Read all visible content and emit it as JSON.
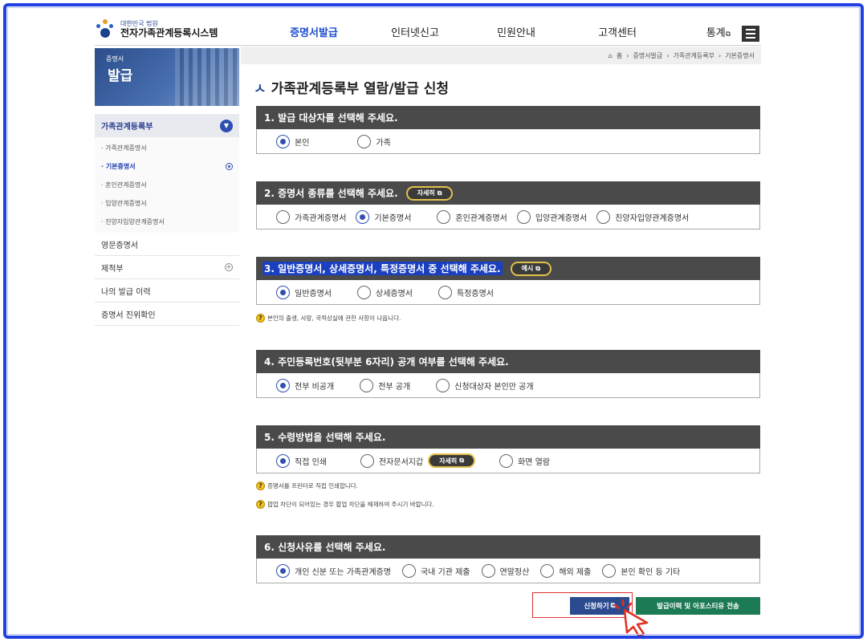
{
  "header": {
    "logo_small": "대한민국 법원",
    "logo_title": "전자가족관계등록시스템",
    "nav": [
      "증명서발급",
      "인터넷신고",
      "민원안내",
      "고객센터",
      "통계"
    ],
    "nav_active_index": 0,
    "stats_ext_icon": "external-link-icon",
    "menu_icon": "hamburger-icon"
  },
  "breadcrumb": {
    "home_icon": "home-icon",
    "items": [
      "홈",
      "증명서발급",
      "가족관계등록부",
      "기본증명서"
    ]
  },
  "sidebar": {
    "banner_small": "증명서",
    "banner_big": "발급",
    "category": "가족관계등록부",
    "sub_items": [
      "· 가족관계증명서",
      "· 기본증명서",
      "· 혼인관계증명서",
      "· 입양관계증명서",
      "· 친양자입양관계증명서"
    ],
    "sub_active_index": 1,
    "items": [
      "영문증명서",
      "제적부",
      "나의 발급 이력",
      "증명서 진위확인"
    ]
  },
  "page_title": "가족관계등록부 열람/발급 신청",
  "sections": {
    "s1": {
      "title": "1. 발급 대상자를 선택해 주세요.",
      "options": [
        "본인",
        "가족"
      ],
      "selected": 0
    },
    "s2": {
      "title": "2. 증명서 종류를 선택해 주세요.",
      "pill": "자세히",
      "options": [
        "가족관계증명서",
        "기본증명서",
        "혼인관계증명서",
        "입양관계증명서",
        "친양자입양관계증명서"
      ],
      "selected": 1
    },
    "s3": {
      "title": "3. 일반증명서, 상세증명서, 특정증명서 중 선택해 주세요.",
      "pill": "예시",
      "options": [
        "일반증명서",
        "상세증명서",
        "특정증명서"
      ],
      "selected": 0,
      "note": "본인의 출생, 사망, 국적상실에 관한 사항이 나옵니다."
    },
    "s4": {
      "title": "4. 주민등록번호(뒷부분 6자리) 공개 여부를 선택해 주세요.",
      "options": [
        "전부 비공개",
        "전부 공개",
        "신청대상자 본인만 공개"
      ],
      "selected": 0
    },
    "s5": {
      "title": "5. 수령방법을 선택해 주세요.",
      "pill": "자세히",
      "options": [
        "직접 인쇄",
        "전자문서지갑",
        "화면 열람"
      ],
      "selected": 0,
      "note1": "증명서를 프린터로 직접 인쇄합니다.",
      "note2": "팝업 차단이 되어있는 경우 팝업 차단을 해제하여 주시기 바랍니다."
    },
    "s6": {
      "title": "6. 신청사유를 선택해 주세요.",
      "options": [
        "개인 신분 또는 가족관계증명",
        "국내 기관 제출",
        "연말정산",
        "해외 제출",
        "본인 확인 등 기타"
      ],
      "selected": 0
    }
  },
  "buttons": {
    "apply": "신청하기",
    "send": "발급이력 및 아포스티유 전송"
  },
  "colors": {
    "accent_blue": "#2f4fb0",
    "section_header": "#4a4a4a",
    "send_green": "#1c7a55",
    "frame_blue": "#1f3fe0"
  }
}
